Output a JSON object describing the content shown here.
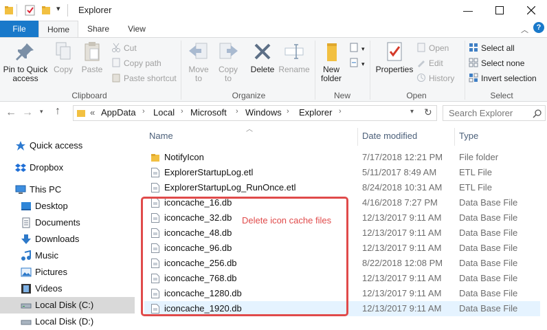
{
  "window": {
    "title": "Explorer"
  },
  "tabs": [
    {
      "label": "File"
    },
    {
      "label": "Home"
    },
    {
      "label": "Share"
    },
    {
      "label": "View"
    }
  ],
  "ribbon": {
    "clipboard": {
      "group_label": "Clipboard",
      "pin_label": "Pin to Quick access",
      "copy_label": "Copy",
      "paste_label": "Paste",
      "cut_label": "Cut",
      "copy_path_label": "Copy path",
      "paste_shortcut_label": "Paste shortcut"
    },
    "organize": {
      "group_label": "Organize",
      "move_to_label": "Move to",
      "copy_to_label": "Copy to",
      "delete_label": "Delete",
      "rename_label": "Rename"
    },
    "new": {
      "group_label": "New",
      "new_folder_label": "New folder"
    },
    "open": {
      "group_label": "Open",
      "properties_label": "Properties",
      "open_label": "Open",
      "edit_label": "Edit",
      "history_label": "History"
    },
    "select": {
      "group_label": "Select",
      "select_all_label": "Select all",
      "select_none_label": "Select none",
      "invert_label": "Invert selection"
    }
  },
  "address": {
    "overflow": "«",
    "crumbs": [
      "AppData",
      "Local",
      "Microsoft",
      "Windows",
      "Explorer"
    ],
    "search_placeholder": "Search Explorer"
  },
  "nav": {
    "items": [
      {
        "label": "Quick access",
        "icon": "star-icon"
      },
      {
        "label": "Dropbox",
        "icon": "dropbox-icon"
      },
      {
        "label": "This PC",
        "icon": "computer-icon"
      },
      {
        "label": "Desktop",
        "icon": "desktop-icon"
      },
      {
        "label": "Documents",
        "icon": "documents-icon"
      },
      {
        "label": "Downloads",
        "icon": "downloads-icon"
      },
      {
        "label": "Music",
        "icon": "music-icon"
      },
      {
        "label": "Pictures",
        "icon": "pictures-icon"
      },
      {
        "label": "Videos",
        "icon": "videos-icon"
      },
      {
        "label": "Local Disk (C:)",
        "icon": "drive-icon"
      },
      {
        "label": "Local Disk (D:)",
        "icon": "drive-icon"
      }
    ]
  },
  "columns": {
    "name": "Name",
    "date": "Date modified",
    "type": "Type"
  },
  "files": [
    {
      "name": "NotifyIcon",
      "date": "7/17/2018 12:21 PM",
      "type": "File folder"
    },
    {
      "name": "ExplorerStartupLog.etl",
      "date": "5/11/2017 8:49 AM",
      "type": "ETL File"
    },
    {
      "name": "ExplorerStartupLog_RunOnce.etl",
      "date": "8/24/2018 10:31 AM",
      "type": "ETL File"
    },
    {
      "name": "iconcache_16.db",
      "date": "4/16/2018 7:27 PM",
      "type": "Data Base File"
    },
    {
      "name": "iconcache_32.db",
      "date": "12/13/2017 9:11 AM",
      "type": "Data Base File"
    },
    {
      "name": "iconcache_48.db",
      "date": "12/13/2017 9:11 AM",
      "type": "Data Base File"
    },
    {
      "name": "iconcache_96.db",
      "date": "12/13/2017 9:11 AM",
      "type": "Data Base File"
    },
    {
      "name": "iconcache_256.db",
      "date": "8/22/2018 12:08 PM",
      "type": "Data Base File"
    },
    {
      "name": "iconcache_768.db",
      "date": "12/13/2017 9:11 AM",
      "type": "Data Base File"
    },
    {
      "name": "iconcache_1280.db",
      "date": "12/13/2017 9:11 AM",
      "type": "Data Base File"
    },
    {
      "name": "iconcache_1920.db",
      "date": "12/13/2017 9:11 AM",
      "type": "Data Base File"
    }
  ],
  "annotation": {
    "text": "Delete icon cache files",
    "color": "#e04a4a"
  },
  "colors": {
    "accent": "#1979ca",
    "folder": "#f2c041",
    "selection": "#e5f3ff"
  }
}
